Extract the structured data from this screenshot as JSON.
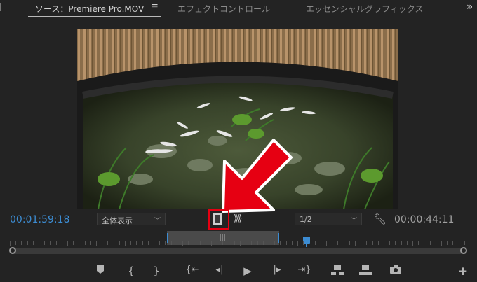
{
  "tabs": {
    "source": "ソース：Premiere Pro.MOV",
    "menu_icon": "≡",
    "effect_controls": "エフェクトコントロール",
    "essential_graphics": "エッセンシャルグラフィックス",
    "overflow": "»"
  },
  "monitor": {
    "current_timecode": "00:01:59:18",
    "duration_timecode": "00:00:44:11",
    "fit_value": "全体表示",
    "resolution_value": "1/2",
    "drag_video_only_icon": "filmstrip-icon",
    "drag_audio_only_icon": "waveform-icon",
    "settings_icon": "wrench-icon"
  },
  "timeline": {
    "in_out_label": "|||"
  },
  "transport": {
    "marker": "marker-icon",
    "mark_in": "mark-in-icon",
    "mark_out": "mark-out-icon",
    "go_to_in": "go-to-in-icon",
    "step_back": "step-back-icon",
    "play": "play-icon",
    "step_forward": "step-forward-icon",
    "go_to_out": "go-to-out-icon",
    "insert": "insert-icon",
    "overwrite": "overwrite-icon",
    "export_frame": "camera-icon",
    "add": "plus-icon"
  },
  "colors": {
    "accent_blue": "#3c8cd2",
    "annotation_red": "#e60012"
  }
}
